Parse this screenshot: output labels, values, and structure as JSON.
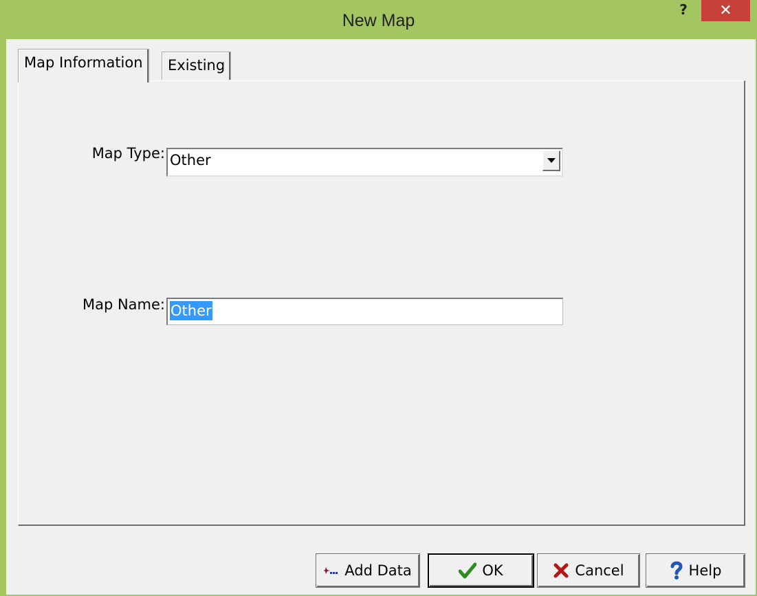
{
  "window": {
    "title": "New Map",
    "help_glyph": "?",
    "close_glyph": "✕"
  },
  "tabs": [
    {
      "label": "Map Information",
      "active": true
    },
    {
      "label": "Existing",
      "active": false
    }
  ],
  "form": {
    "map_type_label": "Map Type:",
    "map_type_value": "Other",
    "map_name_label": "Map Name:",
    "map_name_value": "Other"
  },
  "buttons": {
    "add_data": "Add Data",
    "ok": "OK",
    "cancel": "Cancel",
    "help": "Help"
  },
  "colors": {
    "titlebar": "#a4c660",
    "close": "#c7403a",
    "selection": "#3399ff"
  },
  "icons": {
    "add_data": "add-data-icon",
    "ok": "checkmark-icon",
    "cancel": "x-icon",
    "help": "question-mark-icon"
  }
}
